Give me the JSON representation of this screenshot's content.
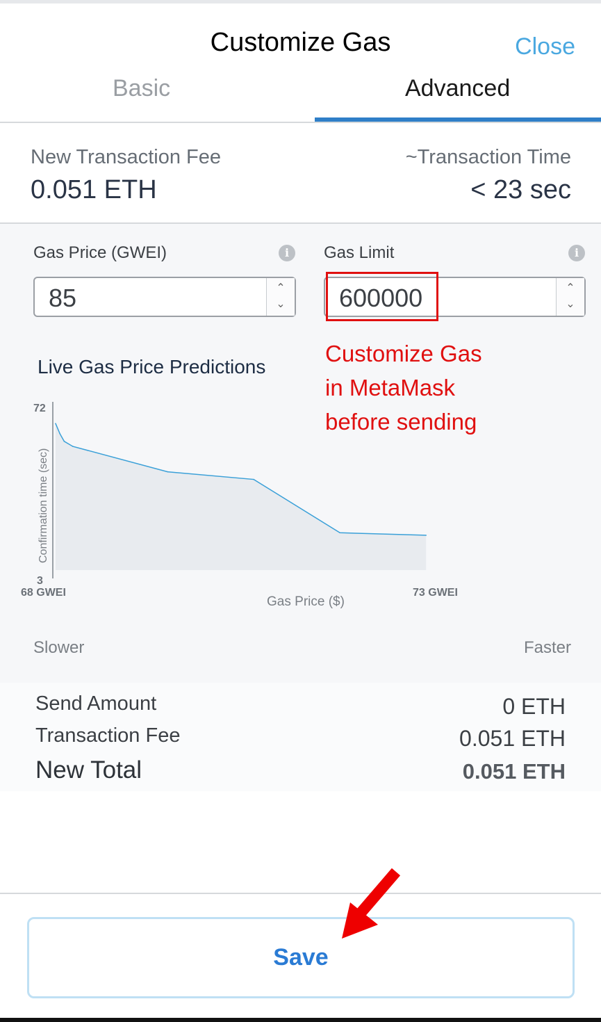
{
  "header": {
    "title": "Customize Gas",
    "close_label": "Close",
    "tabs": [
      {
        "label": "Basic",
        "active": false
      },
      {
        "label": "Advanced",
        "active": true
      }
    ]
  },
  "summary_top": {
    "fee_label": "New Transaction Fee",
    "fee_value": "0.051 ETH",
    "time_label": "~Transaction Time",
    "time_value": "< 23 sec"
  },
  "gas_price": {
    "label": "Gas Price (GWEI)",
    "value": "85"
  },
  "gas_limit": {
    "label": "Gas Limit",
    "value": "600000"
  },
  "annotation": {
    "line1": "Customize Gas",
    "line2": "in MetaMask",
    "line3": "before sending"
  },
  "predictions": {
    "title": "Live Gas Price Predictions",
    "slower_label": "Slower",
    "faster_label": "Faster"
  },
  "chart_data": {
    "type": "area",
    "title": "Live Gas Price Predictions",
    "xlabel": "Gas Price ($)",
    "ylabel": "Confirmation time (sec)",
    "x_tick_labels": [
      "68 GWEI",
      "73 GWEI"
    ],
    "y_tick_labels": [
      "72",
      "3"
    ],
    "xlim": [
      68,
      73
    ],
    "ylim": [
      3,
      72
    ],
    "x": [
      68,
      68.05,
      68.1,
      68.2,
      69.3,
      70.3,
      71.3,
      72.3
    ],
    "y": [
      64,
      60,
      57,
      55,
      45,
      42,
      21,
      20
    ],
    "line_color": "#3aa0d8",
    "fill_color": "#e8ebef",
    "grid": false
  },
  "totals": {
    "send_amount_label": "Send Amount",
    "send_amount_value": "0 ETH",
    "tx_fee_label": "Transaction Fee",
    "tx_fee_value": "0.051 ETH",
    "new_total_label": "New Total",
    "new_total_value": "0.051 ETH"
  },
  "footer": {
    "save_label": "Save"
  },
  "colors": {
    "accent": "#2a7bd4",
    "close": "#4aa8e0",
    "annotation": "#e01010"
  }
}
